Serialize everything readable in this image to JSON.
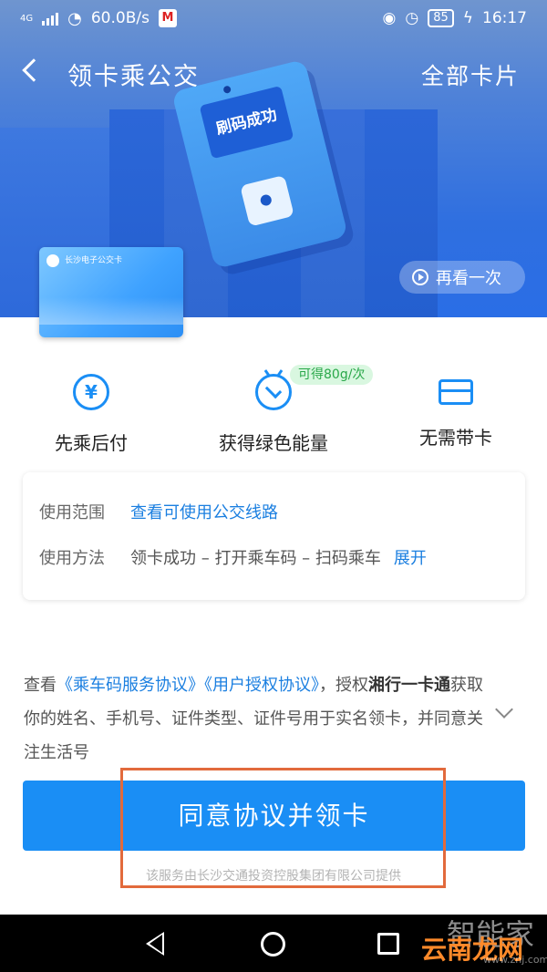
{
  "status_bar": {
    "network": "4G",
    "speed": "60.0B/s",
    "battery": "85",
    "time": "16:17"
  },
  "nav": {
    "title": "领卡乘公交",
    "right_link": "全部卡片"
  },
  "hero": {
    "device_screen_text": "刷码成功",
    "card_name": "长沙电子公交卡",
    "replay_label": "再看一次"
  },
  "features": [
    {
      "icon": "yen-icon",
      "label": "先乘后付"
    },
    {
      "icon": "leaf-icon",
      "label": "获得绿色能量",
      "badge": "可得80g/次"
    },
    {
      "icon": "card-icon",
      "label": "无需带卡"
    }
  ],
  "info": {
    "scope_label": "使用范围",
    "scope_link": "查看可使用公交线路",
    "method_label": "使用方法",
    "method_steps": "领卡成功 – 打开乘车码 – 扫码乘车",
    "method_expand": "展开"
  },
  "agreement": {
    "prefix": "查看",
    "doc1": "《乘车码服务协议》",
    "doc2": "《用户授权协议》",
    "mid": "，授权",
    "company": "湘行一卡通",
    "suffix": "获取你的姓名、手机号、证件类型、证件号用于实名领卡，并同意关注生活号"
  },
  "cta_label": "同意协议并领卡",
  "provider_text": "该服务由长沙交通投资控股集团有限公司提供",
  "watermark": {
    "line1": "智能家",
    "line2": "云南龙网",
    "line3": "www.znj.com"
  },
  "colors": {
    "accent": "#1a8ef5",
    "highlight_box": "#e26a3c",
    "badge_green": "#2aa84a"
  }
}
